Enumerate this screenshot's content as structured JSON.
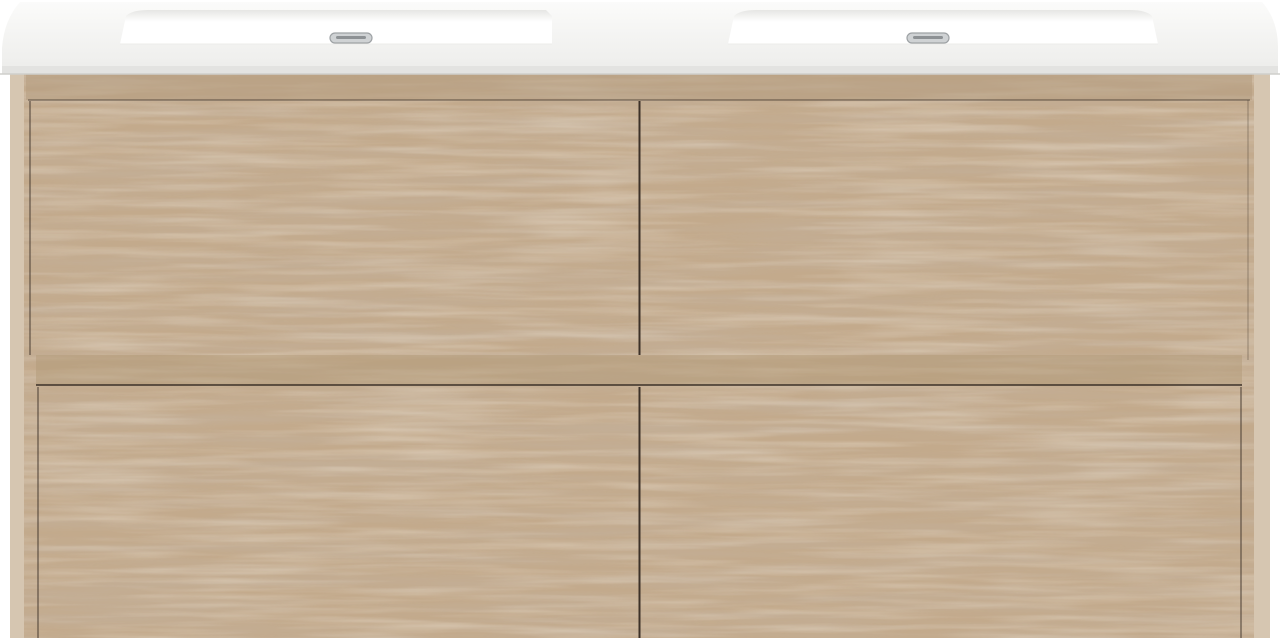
{
  "product": {
    "type": "double-sink-vanity",
    "drawer_count": 4,
    "sink_count": 2,
    "overflow_count": 2
  },
  "colors": {
    "background": "#ffffff",
    "countertop": "#f7f7f6",
    "countertop_edge": "#e3e3e1",
    "basin": "#ffffff",
    "basin_shadow": "#e9e9e7",
    "wood_light": "#c3aa8c",
    "wood_mid": "#ad9274",
    "wood_dark": "#8c735a",
    "frame_side": "#d6c6b1",
    "seam": "#3c3128",
    "overflow_metal": "#cfd2d4"
  },
  "drawers": [
    {
      "name": "drawer-top-left"
    },
    {
      "name": "drawer-top-right"
    },
    {
      "name": "drawer-bottom-left"
    },
    {
      "name": "drawer-bottom-right"
    }
  ]
}
